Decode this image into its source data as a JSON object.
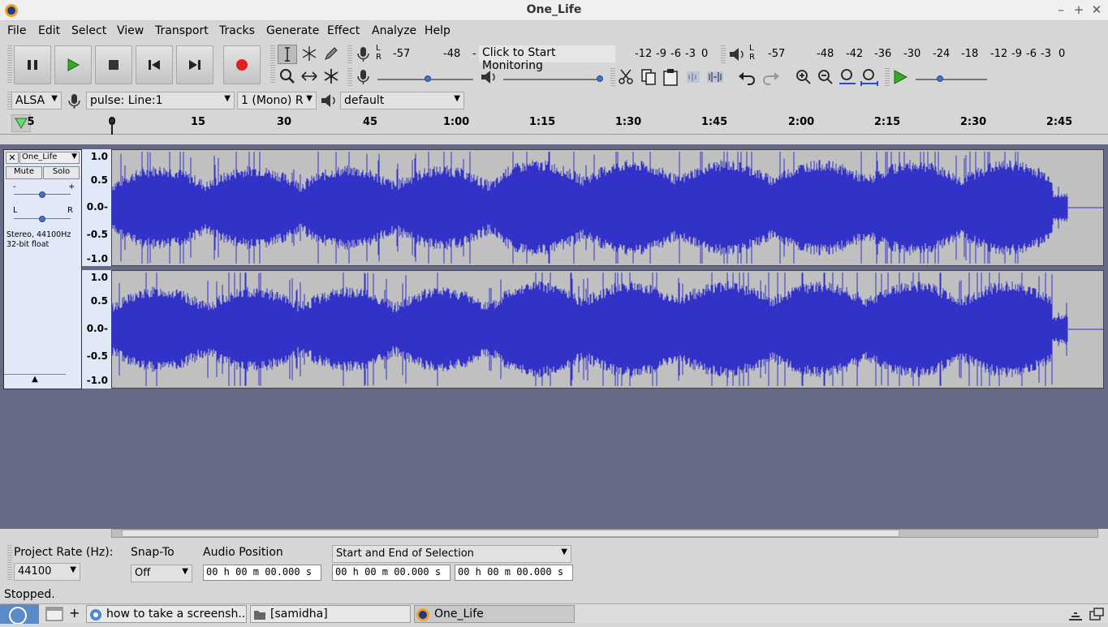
{
  "window": {
    "title": "One_Life",
    "minimize": "–",
    "maximize": "+",
    "close": "✕"
  },
  "menu": [
    "File",
    "Edit",
    "Select",
    "View",
    "Transport",
    "Tracks",
    "Generate",
    "Effect",
    "Analyze",
    "Help"
  ],
  "recording_meter": {
    "lr": "L\nR",
    "ticks": [
      "-57",
      "-48",
      "-",
      "-12",
      "-9",
      "-6",
      "-3",
      "0"
    ],
    "monitor_text": "Click to Start Monitoring"
  },
  "playback_meter": {
    "ticks": [
      "-57",
      "-48",
      "-42",
      "-36",
      "-30",
      "-24",
      "-18",
      "-12",
      "-9",
      "-6",
      "-3",
      "0"
    ]
  },
  "device": {
    "host": "ALSA",
    "input": "pulse: Line:1",
    "channels": "1 (Mono) R",
    "output": "default"
  },
  "ruler": {
    "ticks": [
      "0",
      "15",
      "30",
      "45",
      "1:00",
      "1:15",
      "1:30",
      "1:45",
      "2:00",
      "2:15",
      "2:30",
      "2:45"
    ],
    "left_label": "5"
  },
  "track": {
    "name": "One_Life",
    "mute": "Mute",
    "solo": "Solo",
    "gain_minus": "-",
    "gain_plus": "+",
    "pan_l": "L",
    "pan_r": "R",
    "info1": "Stereo, 44100Hz",
    "info2": "32-bit float",
    "scale": [
      "1.0",
      "0.5",
      "0.0-",
      "-0.5",
      "-1.0"
    ]
  },
  "bottom": {
    "rate_label": "Project Rate (Hz):",
    "rate_value": "44100",
    "snap_label": "Snap-To",
    "snap_value": "Off",
    "pos_label": "Audio Position",
    "sel_label": "Start and End of Selection",
    "time": "00 h 00 m 00.000 s"
  },
  "status": "Stopped.",
  "taskbar": {
    "items": [
      "how to take a screensh...",
      "[samidha]",
      "One_Life"
    ]
  },
  "colors": {
    "waveform": "#3232c8",
    "track_bg": "#c0c0c0",
    "desk": "#666a86"
  }
}
